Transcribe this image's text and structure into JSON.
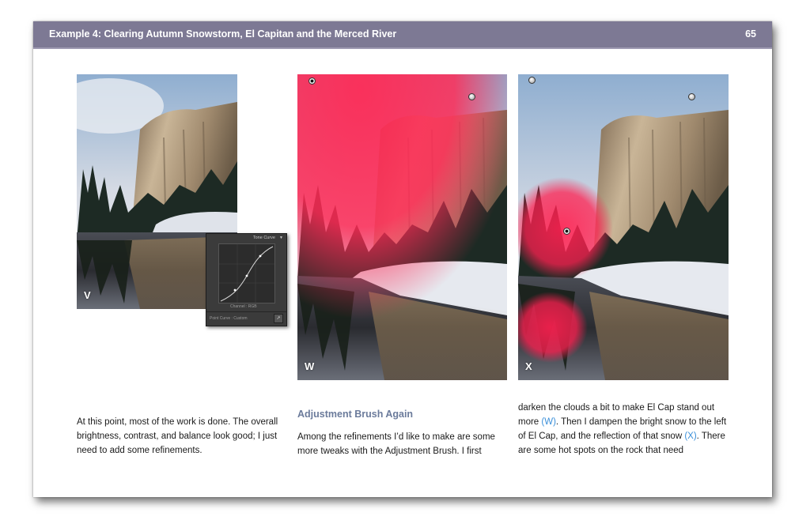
{
  "header": {
    "title": "Example 4: Clearing Autumn Snowstorm, El Capitan and the Merced River",
    "page_number": "65"
  },
  "photos": {
    "v": {
      "label": "V"
    },
    "w": {
      "label": "W"
    },
    "x": {
      "label": "X"
    }
  },
  "tone_curve": {
    "title": "Tone Curve",
    "channel": "Channel :  RGB",
    "point_curve": "Point Curve :   Custom"
  },
  "colors": {
    "header": "#7d7994",
    "heading": "#6b7b9b",
    "reference": "#3a8fd9",
    "mask": "#ff2a55"
  },
  "icons": {
    "tone_menu": "triangle-down-icon",
    "tone_tool": "target-adjust-icon"
  },
  "text": {
    "col1": "At this point, most of the work is done. The overall brightness, contrast, and balance look good; I just need to add some refinements.",
    "heading": "Adjustment Brush Again",
    "col2": "Among the refinements I’d like to make are some more tweaks with the Adjustment Brush. I first",
    "col3_a": "darken the clouds a bit to make El Cap stand out more",
    "col3_ref1": "(W)",
    "col3_b": ". Then I dampen the bright snow to the left of El Cap, and the reflection of that snow",
    "col3_ref2": "(X)",
    "col3_c": ". There are some hot spots on the rock that need"
  }
}
